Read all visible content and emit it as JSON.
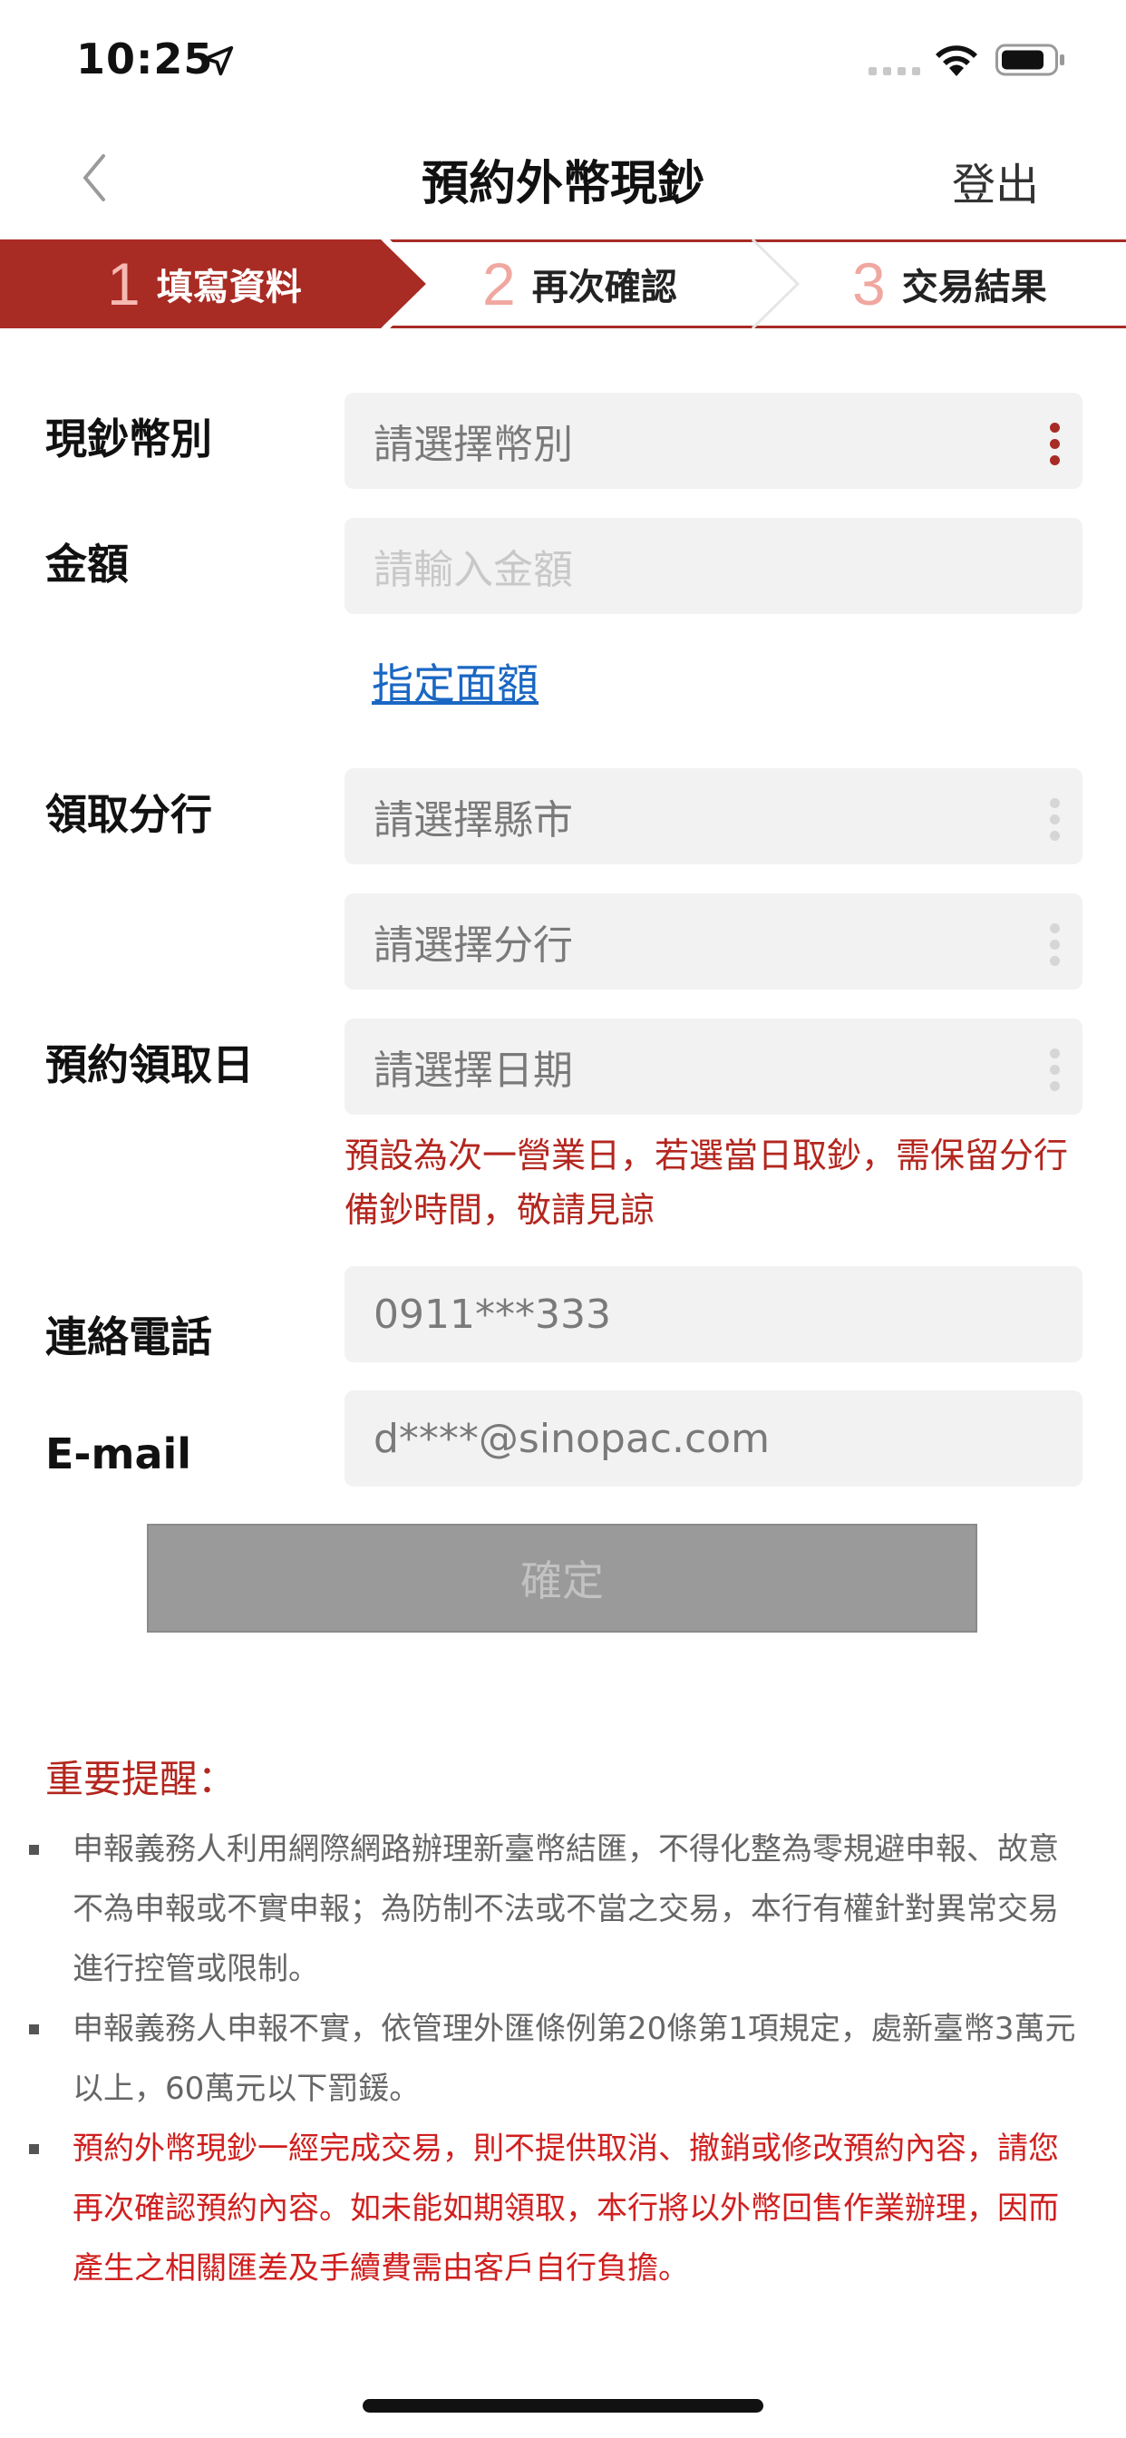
{
  "status_bar": {
    "time": "10:25"
  },
  "nav": {
    "title": "預約外幣現鈔",
    "logout": "登出"
  },
  "steps": [
    {
      "num": "1",
      "label": "填寫資料",
      "active": true
    },
    {
      "num": "2",
      "label": "再次確認",
      "active": false
    },
    {
      "num": "3",
      "label": "交易結果",
      "active": false
    }
  ],
  "form": {
    "currency": {
      "label": "現鈔幣別",
      "value": "請選擇幣別"
    },
    "amount": {
      "label": "金額",
      "placeholder": "請輸入金額"
    },
    "denomination_link": "指定面額",
    "branch": {
      "label": "領取分行",
      "city_value": "請選擇縣市",
      "branch_value": "請選擇分行"
    },
    "date": {
      "label": "預約領取日",
      "value": "請選擇日期",
      "note": "預設為次一營業日，若選當日取鈔，需保留分行備鈔時間，敬請見諒"
    },
    "phone": {
      "label": "連絡電話",
      "value": "0911***333"
    },
    "email": {
      "label": "E-mail",
      "value": "d****@sinopac.com"
    },
    "submit": "確定"
  },
  "reminder": {
    "title": "重要提醒：",
    "items": [
      "申報義務人利用網際網路辦理新臺幣結匯，不得化整為零規避申報、故意不為申報或不實申報；為防制不法或不當之交易，本行有權針對異常交易進行控管或限制。",
      "申報義務人申報不實，依管理外匯條例第20條第1項規定，處新臺幣3萬元以上，60萬元以下罰鍰。",
      "預約外幣現鈔一經完成交易，則不提供取消、撤銷或修改預約內容，請您再次確認預約內容。如未能如期領取，本行將以外幣回售作業辦理，因而產生之相關匯差及手續費需由客戶自行負擔。"
    ]
  },
  "colors": {
    "brand": "#a82b24",
    "link": "#1a67c3",
    "warning": "#d01f1f"
  }
}
